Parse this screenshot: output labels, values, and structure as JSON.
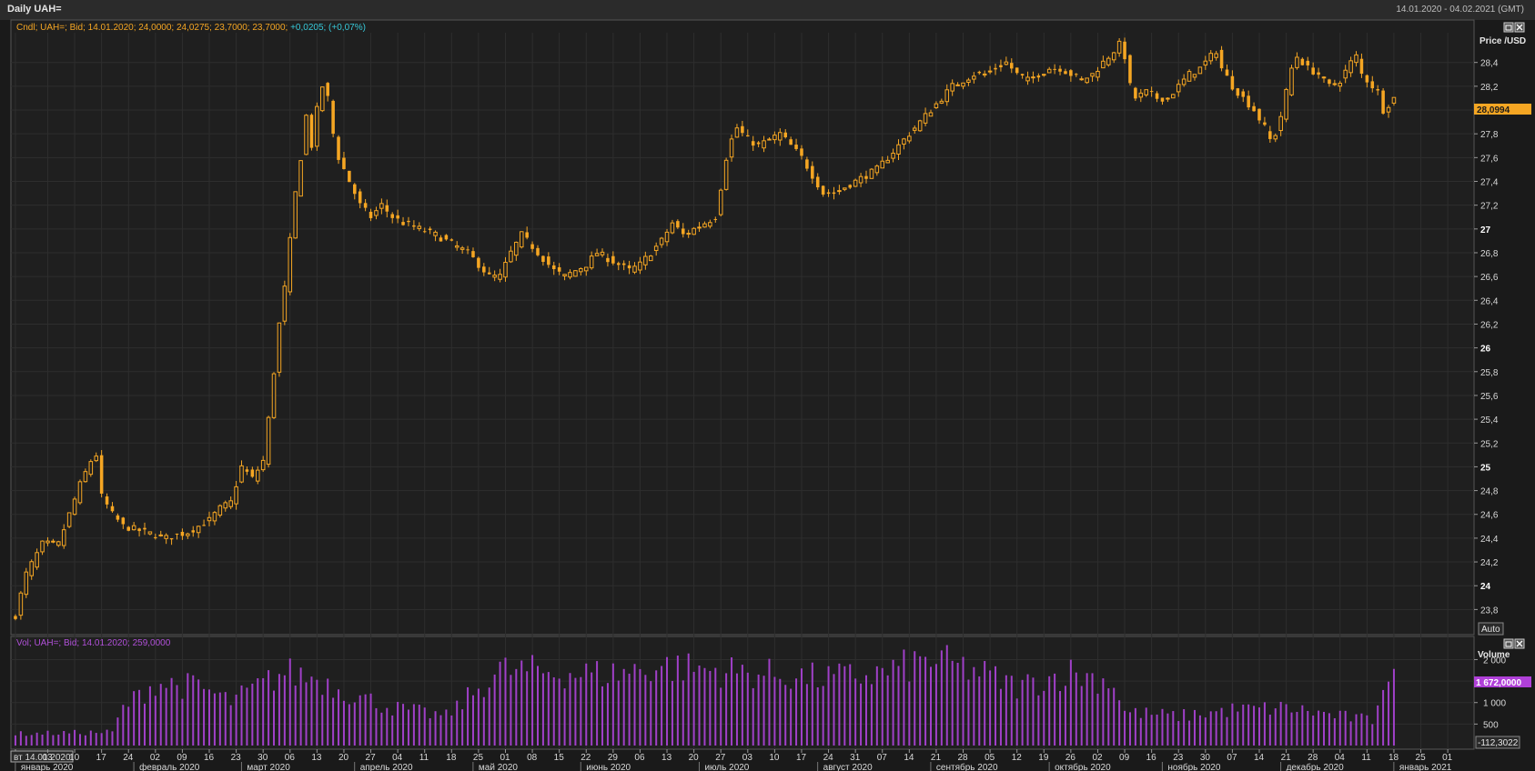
{
  "window": {
    "title": "Daily UAH=",
    "date_range": "14.01.2020 - 04.02.2021 (GMT)"
  },
  "colors": {
    "candle": "#f5a623",
    "volume": "#a040c8",
    "legend_change": "#37c8d8",
    "legend_volume": "#b050d8",
    "background": "#1f1f1f",
    "grid": "#2e2e2e"
  },
  "icons": {
    "pane_restore": "restore-icon",
    "pane_close": "close-icon"
  },
  "chart_data": [
    {
      "type": "candlestick",
      "legend": {
        "text": "Cndl; UAH=; Bid; 14.01.2020; 24,0000; 24,0275; 23,7000; 23,7000;",
        "change": "+0,0205; (+0,07%)"
      },
      "y_axis_title": "Price\n/USD",
      "ylim": [
        23.65,
        28.65
      ],
      "y_ticks": [
        "23,8",
        "24",
        "24,2",
        "24,4",
        "24,6",
        "24,8",
        "25",
        "25,2",
        "25,4",
        "25,6",
        "25,8",
        "26",
        "26,2",
        "26,4",
        "26,6",
        "26,8",
        "27",
        "27,2",
        "27,4",
        "27,6",
        "27,8",
        "28",
        "28,2",
        "28,4"
      ],
      "last_price_label": "28,0994",
      "auto_button": "Auto",
      "path": [
        [
          0,
          23.75
        ],
        [
          2,
          24.1
        ],
        [
          5,
          24.35
        ],
        [
          8,
          24.35
        ],
        [
          10,
          24.6
        ],
        [
          12,
          24.85
        ],
        [
          14,
          25.05
        ],
        [
          15,
          25.1
        ],
        [
          16,
          24.75
        ],
        [
          18,
          24.6
        ],
        [
          20,
          24.5
        ],
        [
          24,
          24.45
        ],
        [
          28,
          24.4
        ],
        [
          32,
          24.45
        ],
        [
          36,
          24.55
        ],
        [
          38,
          24.65
        ],
        [
          40,
          24.7
        ],
        [
          42,
          25.0
        ],
        [
          44,
          24.9
        ],
        [
          46,
          25.05
        ],
        [
          47,
          25.4
        ],
        [
          48,
          25.8
        ],
        [
          49,
          26.2
        ],
        [
          50,
          26.5
        ],
        [
          51,
          26.9
        ],
        [
          52,
          27.3
        ],
        [
          53,
          27.6
        ],
        [
          54,
          27.95
        ],
        [
          55,
          27.7
        ],
        [
          56,
          28.0
        ],
        [
          57,
          28.2
        ],
        [
          58,
          28.1
        ],
        [
          59,
          27.8
        ],
        [
          60,
          27.6
        ],
        [
          62,
          27.4
        ],
        [
          64,
          27.2
        ],
        [
          66,
          27.1
        ],
        [
          68,
          27.2
        ],
        [
          70,
          27.1
        ],
        [
          72,
          27.05
        ],
        [
          75,
          27.0
        ],
        [
          78,
          26.95
        ],
        [
          80,
          26.9
        ],
        [
          82,
          26.85
        ],
        [
          84,
          26.8
        ],
        [
          86,
          26.7
        ],
        [
          88,
          26.6
        ],
        [
          90,
          26.6
        ],
        [
          92,
          26.8
        ],
        [
          94,
          26.95
        ],
        [
          96,
          26.85
        ],
        [
          98,
          26.75
        ],
        [
          100,
          26.65
        ],
        [
          102,
          26.6
        ],
        [
          104,
          26.65
        ],
        [
          106,
          26.7
        ],
        [
          108,
          26.8
        ],
        [
          110,
          26.75
        ],
        [
          112,
          26.7
        ],
        [
          114,
          26.65
        ],
        [
          116,
          26.7
        ],
        [
          118,
          26.8
        ],
        [
          120,
          26.9
        ],
        [
          122,
          27.05
        ],
        [
          124,
          26.95
        ],
        [
          126,
          27.0
        ],
        [
          128,
          27.05
        ],
        [
          130,
          27.1
        ],
        [
          131,
          27.35
        ],
        [
          132,
          27.6
        ],
        [
          133,
          27.75
        ],
        [
          134,
          27.85
        ],
        [
          136,
          27.75
        ],
        [
          138,
          27.7
        ],
        [
          140,
          27.75
        ],
        [
          142,
          27.8
        ],
        [
          144,
          27.7
        ],
        [
          146,
          27.6
        ],
        [
          148,
          27.45
        ],
        [
          150,
          27.3
        ],
        [
          152,
          27.3
        ],
        [
          154,
          27.35
        ],
        [
          156,
          27.4
        ],
        [
          158,
          27.45
        ],
        [
          160,
          27.5
        ],
        [
          162,
          27.6
        ],
        [
          164,
          27.7
        ],
        [
          166,
          27.8
        ],
        [
          168,
          27.9
        ],
        [
          170,
          28.0
        ],
        [
          172,
          28.1
        ],
        [
          174,
          28.2
        ],
        [
          176,
          28.25
        ],
        [
          178,
          28.3
        ],
        [
          180,
          28.3
        ],
        [
          182,
          28.35
        ],
        [
          184,
          28.4
        ],
        [
          186,
          28.3
        ],
        [
          188,
          28.25
        ],
        [
          190,
          28.3
        ],
        [
          192,
          28.35
        ],
        [
          194,
          28.35
        ],
        [
          196,
          28.3
        ],
        [
          198,
          28.25
        ],
        [
          200,
          28.3
        ],
        [
          202,
          28.4
        ],
        [
          204,
          28.5
        ],
        [
          205,
          28.55
        ],
        [
          206,
          28.45
        ],
        [
          207,
          28.2
        ],
        [
          208,
          28.1
        ],
        [
          210,
          28.15
        ],
        [
          212,
          28.1
        ],
        [
          214,
          28.1
        ],
        [
          216,
          28.2
        ],
        [
          218,
          28.3
        ],
        [
          220,
          28.35
        ],
        [
          222,
          28.45
        ],
        [
          223,
          28.5
        ],
        [
          224,
          28.35
        ],
        [
          226,
          28.2
        ],
        [
          228,
          28.1
        ],
        [
          230,
          28.0
        ],
        [
          232,
          27.85
        ],
        [
          233,
          27.75
        ],
        [
          234,
          27.8
        ],
        [
          235,
          27.95
        ],
        [
          236,
          28.15
        ],
        [
          237,
          28.35
        ],
        [
          238,
          28.45
        ],
        [
          240,
          28.35
        ],
        [
          242,
          28.3
        ],
        [
          244,
          28.2
        ],
        [
          246,
          28.25
        ],
        [
          248,
          28.4
        ],
        [
          249,
          28.45
        ],
        [
          250,
          28.3
        ],
        [
          252,
          28.2
        ],
        [
          253,
          28.15
        ],
        [
          254,
          28.0
        ],
        [
          255,
          28.05
        ],
        [
          256,
          28.1
        ]
      ],
      "x_ticks": [
        {
          "i": 0,
          "label": "вт 14.01.2020"
        },
        {
          "i": 6,
          "label": "03"
        },
        {
          "i": 11,
          "label": "10"
        },
        {
          "i": 16,
          "label": "17"
        },
        {
          "i": 21,
          "label": "24"
        },
        {
          "i": 26,
          "label": "02"
        },
        {
          "i": 31,
          "label": "09"
        },
        {
          "i": 36,
          "label": "16"
        },
        {
          "i": 41,
          "label": "23"
        },
        {
          "i": 46,
          "label": "30"
        },
        {
          "i": 51,
          "label": "06"
        },
        {
          "i": 56,
          "label": "13"
        },
        {
          "i": 61,
          "label": "20"
        },
        {
          "i": 66,
          "label": "27"
        },
        {
          "i": 71,
          "label": "04"
        },
        {
          "i": 76,
          "label": "11"
        },
        {
          "i": 81,
          "label": "18"
        },
        {
          "i": 86,
          "label": "25"
        },
        {
          "i": 91,
          "label": "01"
        },
        {
          "i": 96,
          "label": "08"
        },
        {
          "i": 101,
          "label": "15"
        },
        {
          "i": 106,
          "label": "22"
        },
        {
          "i": 111,
          "label": "29"
        },
        {
          "i": 116,
          "label": "06"
        },
        {
          "i": 121,
          "label": "13"
        },
        {
          "i": 126,
          "label": "20"
        },
        {
          "i": 131,
          "label": "27"
        },
        {
          "i": 136,
          "label": "03"
        },
        {
          "i": 141,
          "label": "10"
        },
        {
          "i": 146,
          "label": "17"
        },
        {
          "i": 151,
          "label": "24"
        },
        {
          "i": 156,
          "label": "31"
        },
        {
          "i": 161,
          "label": "07"
        },
        {
          "i": 166,
          "label": "14"
        },
        {
          "i": 171,
          "label": "21"
        },
        {
          "i": 176,
          "label": "28"
        },
        {
          "i": 181,
          "label": "05"
        },
        {
          "i": 186,
          "label": "12"
        },
        {
          "i": 191,
          "label": "19"
        },
        {
          "i": 196,
          "label": "26"
        },
        {
          "i": 201,
          "label": "02"
        },
        {
          "i": 206,
          "label": "09"
        },
        {
          "i": 211,
          "label": "16"
        },
        {
          "i": 216,
          "label": "23"
        },
        {
          "i": 221,
          "label": "30"
        },
        {
          "i": 226,
          "label": "07"
        },
        {
          "i": 231,
          "label": "14"
        },
        {
          "i": 236,
          "label": "21"
        },
        {
          "i": 241,
          "label": "28"
        },
        {
          "i": 246,
          "label": "04"
        },
        {
          "i": 251,
          "label": "11"
        },
        {
          "i": 256,
          "label": "18"
        },
        {
          "i": 261,
          "label": "25"
        },
        {
          "i": 266,
          "label": "01"
        }
      ],
      "months": [
        {
          "i": 1,
          "label": "январь 2020"
        },
        {
          "i": 23,
          "label": "февраль 2020"
        },
        {
          "i": 43,
          "label": "март 2020"
        },
        {
          "i": 64,
          "label": "апрель 2020"
        },
        {
          "i": 86,
          "label": "май 2020"
        },
        {
          "i": 106,
          "label": "июнь 2020"
        },
        {
          "i": 128,
          "label": "июль 2020"
        },
        {
          "i": 150,
          "label": "август 2020"
        },
        {
          "i": 171,
          "label": "сентябрь 2020"
        },
        {
          "i": 193,
          "label": "октябрь 2020"
        },
        {
          "i": 214,
          "label": "ноябрь 2020"
        },
        {
          "i": 236,
          "label": "декабрь 2020"
        },
        {
          "i": 257,
          "label": "январь 2021"
        }
      ]
    },
    {
      "type": "bar",
      "legend": {
        "text": "Vol; UAH=; Bid; 14.01.2020; 259,0000"
      },
      "y_axis_title": "Volume",
      "ylim": [
        0,
        2200
      ],
      "y_ticks": [
        "500",
        "1 000",
        "1 500",
        "2 000"
      ],
      "last_volume_label": "1 672,0000",
      "min_label": "-112,3022",
      "profile": [
        [
          0,
          280
        ],
        [
          18,
          320
        ],
        [
          20,
          900
        ],
        [
          26,
          1500
        ],
        [
          34,
          1400
        ],
        [
          40,
          1050
        ],
        [
          50,
          1750
        ],
        [
          56,
          1600
        ],
        [
          62,
          1250
        ],
        [
          70,
          900
        ],
        [
          80,
          700
        ],
        [
          90,
          1800
        ],
        [
          110,
          1700
        ],
        [
          120,
          1900
        ],
        [
          130,
          1800
        ],
        [
          140,
          1700
        ],
        [
          150,
          1600
        ],
        [
          160,
          1700
        ],
        [
          170,
          2050
        ],
        [
          178,
          1800
        ],
        [
          186,
          1400
        ],
        [
          196,
          1750
        ],
        [
          204,
          1500
        ],
        [
          206,
          800
        ],
        [
          216,
          700
        ],
        [
          226,
          850
        ],
        [
          236,
          900
        ],
        [
          246,
          700
        ],
        [
          252,
          600
        ],
        [
          254,
          1600
        ],
        [
          256,
          1680
        ]
      ]
    }
  ]
}
